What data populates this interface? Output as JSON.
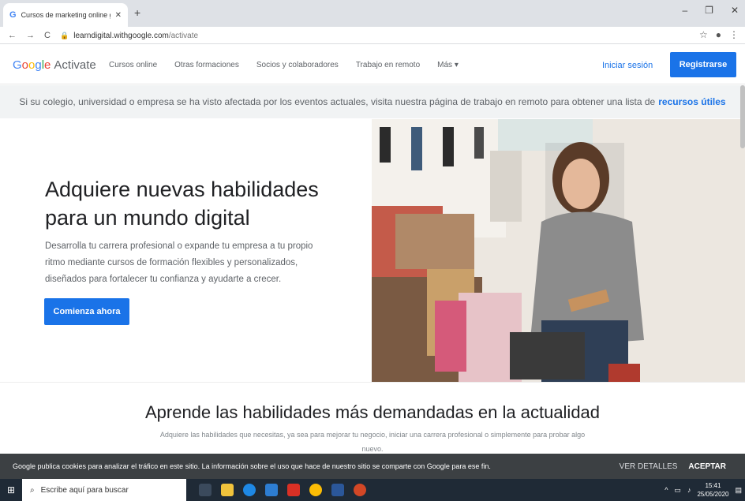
{
  "browser": {
    "tab_title": "Cursos de marketing online grat",
    "url_domain": "learndigital.withgoogle.com",
    "url_path": "/activate"
  },
  "header": {
    "logo_google": "Google",
    "logo_activate": "Activate",
    "nav": [
      "Cursos online",
      "Otras formaciones",
      "Socios y colaboradores",
      "Trabajo en remoto",
      "Más ▾"
    ],
    "signin": "Iniciar sesión",
    "register": "Registrarse"
  },
  "banner": {
    "text": "Si su colegio, universidad o empresa se ha visto afectada por los eventos actuales, visita nuestra página de trabajo en remoto para obtener una lista de",
    "link": "recursos útiles"
  },
  "hero": {
    "title": "Adquiere nuevas habilidades para un mundo digital",
    "description": "Desarrolla tu carrera profesional o expande tu empresa a tu propio ritmo mediante cursos de formación flexibles y personalizados, diseñados para fortalecer tu confianza y ayudarte a crecer.",
    "cta": "Comienza ahora"
  },
  "section": {
    "title": "Aprende las habilidades más demandadas en la actualidad",
    "subtitle": "Adquiere las habilidades que necesitas, ya sea para mejorar tu negocio, iniciar una carrera profesional o simplemente para probar algo nuevo."
  },
  "cookie": {
    "message": "Google publica cookies para analizar el tráfico en este sitio. La información sobre el uso que hace de nuestro sitio se comparte con Google para ese fin.",
    "details": "VER DETALLES",
    "accept": "ACEPTAR"
  },
  "taskbar": {
    "search_placeholder": "Escribe aquí para buscar",
    "time": "15:41",
    "date": "25/05/2020"
  },
  "colors": {
    "accent": "#1a73e8",
    "cookie_bg": "#3c4043",
    "taskbar_bg": "#1f2a36"
  }
}
